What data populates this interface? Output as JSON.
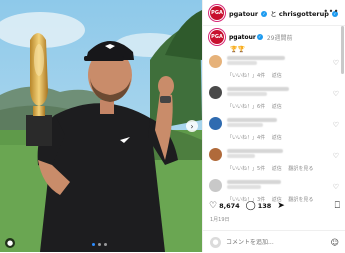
{
  "post": {
    "author": "pgatour",
    "connector": "と",
    "coauthor": "chrisgotterup",
    "more_icon": "more-dots-icon",
    "time_ago": "29週間前",
    "caption_emoji": "🏆🏆",
    "likes": "8,674",
    "comments_count": "138",
    "date": "1月19日",
    "comment_placeholder": "コメントを追加...",
    "avatar_text": "PGA"
  },
  "comments": [
    {
      "meta": [
        "「いいね！」4件",
        "返信"
      ],
      "avatar_color": "#e6b27a"
    },
    {
      "meta": [
        "「いいね！」6件",
        "返信"
      ],
      "avatar_color": "#4a4a4a"
    },
    {
      "meta": [
        "「いいね！」4件",
        "返信"
      ],
      "avatar_color": "#2f6bb0"
    },
    {
      "meta": [
        "「いいね！」5件",
        "返信",
        "翻訳を見る"
      ],
      "avatar_color": "#b06a3a"
    },
    {
      "meta": [
        "「いいね！」3件",
        "返信",
        "翻訳を見る"
      ],
      "avatar_color": "#c8c8c8"
    }
  ],
  "colors": {
    "accent": "#1d9bf0",
    "brand": "#c8102e",
    "carousel_active": "#2b8cff"
  }
}
